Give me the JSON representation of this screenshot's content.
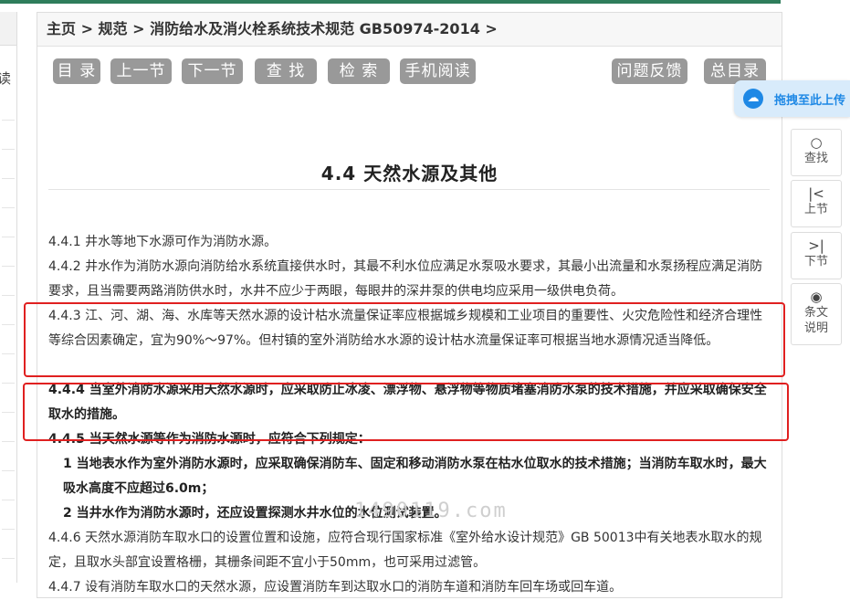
{
  "breadcrumb": "主页 > 规范 > 消防给水及消火栓系统技术规范 GB50974-2014 >",
  "left_tab_char": "读",
  "toolbar": {
    "toc": "目 录",
    "prev": "上一节",
    "next": "下一节",
    "search": "查 找",
    "lookup": "检 索",
    "mobile": "手机阅读",
    "feedback": "问题反馈",
    "contents": "总目录"
  },
  "upload_label": "拖拽至此上传",
  "side_tools": {
    "search": "查找",
    "prev": "上节",
    "next": "下节",
    "explain_line1": "条文",
    "explain_line2": "说明"
  },
  "section_title": "4.4 天然水源及其他",
  "paragraphs": {
    "p441": "4.4.1 井水等地下水源可作为消防水源。",
    "p442": "4.4.2 井水作为消防水源向消防给水系统直接供水时，其最不利水位应满足水泵吸水要求，其最小出流量和水泵扬程应满足消防要求，且当需要两路消防供水时，水井不应少于两眼，每眼井的深井泵的供电均应采用一级供电负荷。",
    "p443": "4.4.3 江、河、湖、海、水库等天然水源的设计枯水流量保证率应根据城乡规模和工业项目的重要性、火灾危险性和经济合理性等综合因素确定，宜为90%～97%。但村镇的室外消防给水水源的设计枯水流量保证率可根据当地水源情况适当降低。",
    "p444": "4.4.4 当室外消防水源采用天然水源时，应采取防止冰凌、漂浮物、悬浮物等物质堵塞消防水泵的技术措施，并应采取确保安全取水的措施。",
    "p445": "4.4.5 当天然水源等作为消防水源时，应符合下列规定：",
    "p445_1": "1 当地表水作为室外消防水源时，应采取确保消防车、固定和移动消防水泵在枯水位取水的技术措施；当消防车取水时，最大吸水高度不应超过6.0m；",
    "p445_2": "2 当井水作为消防水源时，还应设置探测水井水位的水位测试装置。",
    "p446": "4.4.6 天然水源消防车取水口的设置位置和设施，应符合现行国家标准《室外给水设计规范》GB 50013中有关地表水取水的规定，且取水头部宜设置格栅，其栅条间距不宜小于50mm，也可采用过滤管。",
    "p447": "4.4.7 设有消防车取水口的天然水源，应设置消防车到达取水口的消防车道和消防车回车场或回车道。"
  },
  "watermark": "1490119.com",
  "colors": {
    "topbar": "#2e7d5b",
    "button": "#999999",
    "highlight": "#e02020",
    "upload_accent": "#1e88e5"
  }
}
